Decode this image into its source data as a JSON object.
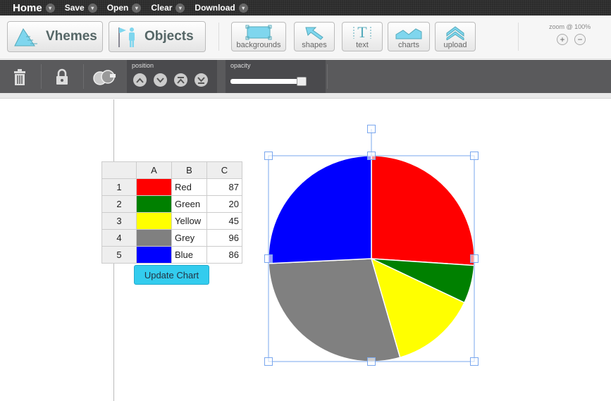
{
  "menu": {
    "home": "Home",
    "items": [
      "Save",
      "Open",
      "Clear",
      "Download"
    ]
  },
  "toolbar": {
    "themes_label": "Vhemes",
    "objects_label": "Objects",
    "tools": [
      "backgrounds",
      "shapes",
      "text",
      "charts",
      "upload"
    ],
    "zoom_label": "zoom @ 100%",
    "zoom_in": "+",
    "zoom_out": "−"
  },
  "subbar": {
    "position_label": "position",
    "opacity_label": "opacity",
    "opacity_value": 0.95
  },
  "table": {
    "headers": [
      "A",
      "B",
      "C"
    ],
    "rows": [
      {
        "index": "1",
        "color": "#ff0000",
        "name": "Red",
        "value": "87"
      },
      {
        "index": "2",
        "color": "#008000",
        "name": "Green",
        "value": "20"
      },
      {
        "index": "3",
        "color": "#ffff00",
        "name": "Yellow",
        "value": "45"
      },
      {
        "index": "4",
        "color": "#808080",
        "name": "Grey",
        "value": "96"
      },
      {
        "index": "5",
        "color": "#0000ff",
        "name": "Blue",
        "value": "86"
      }
    ],
    "update_button": "Update Chart"
  },
  "chart_data": {
    "type": "pie",
    "categories": [
      "Red",
      "Green",
      "Yellow",
      "Grey",
      "Blue"
    ],
    "values": [
      87,
      20,
      45,
      96,
      86
    ],
    "colors": [
      "#ff0000",
      "#008000",
      "#ffff00",
      "#808080",
      "#0000ff"
    ],
    "title": "",
    "selected": true
  }
}
